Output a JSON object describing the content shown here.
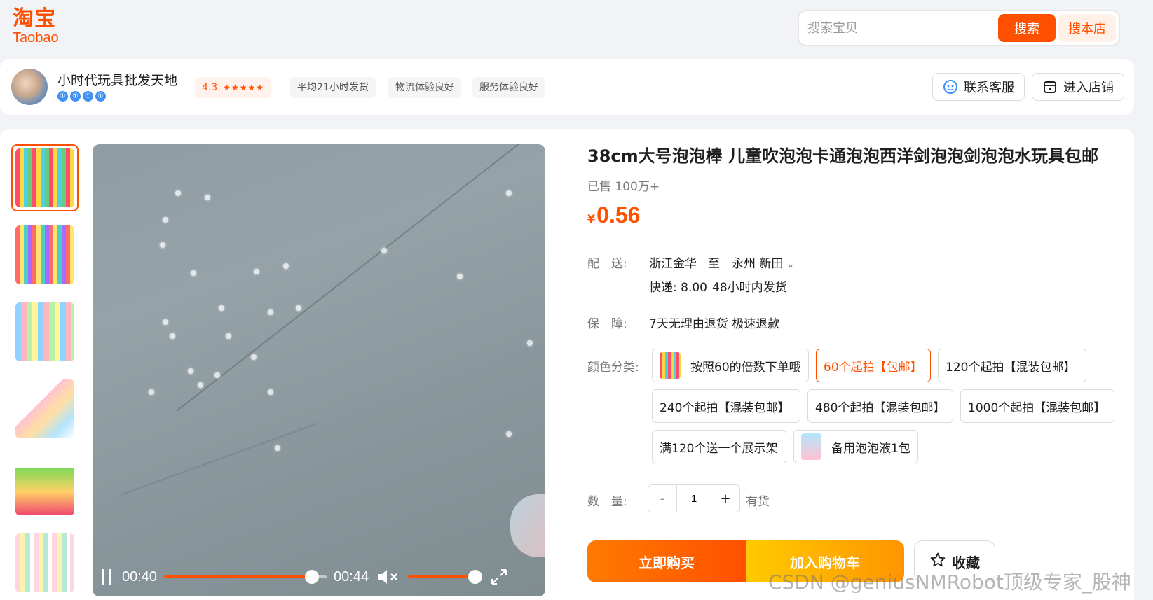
{
  "logo": {
    "cn": "淘宝",
    "en": "Taobao"
  },
  "search": {
    "placeholder": "搜索宝贝",
    "search_btn": "搜索",
    "shop_search_btn": "搜本店"
  },
  "shop": {
    "name": "小时代玩具批发天地",
    "rating": "4.3",
    "stars": "★★★★★",
    "crowns": [
      "①",
      "①",
      "①",
      "①"
    ],
    "tags": [
      "平均21小时发货",
      "物流体验良好",
      "服务体验良好"
    ],
    "contact_btn": "联系客服",
    "enter_btn": "进入店铺"
  },
  "video": {
    "current_time": "00:40",
    "duration": "00:44",
    "progress": 0.91,
    "volume": 1.0
  },
  "product": {
    "title": "38cm大号泡泡棒 儿童吹泡泡卡通泡泡西洋剑泡泡剑泡泡水玩具包邮",
    "sold": "已售 100万+",
    "currency": "¥",
    "price": "0.56"
  },
  "delivery": {
    "label": "配　送:",
    "from": "浙江金华",
    "to_word": "至",
    "to": "永州 新田",
    "express": "快递: 8.00",
    "ship_time": "48小时内发货"
  },
  "guarantee": {
    "label": "保　障:",
    "text": "7天无理由退货 极速退款"
  },
  "color": {
    "label": "颜色分类:",
    "options": [
      "按照60的倍数下单哦",
      "60个起拍【包邮】",
      "120个起拍【混装包邮】",
      "240个起拍【混装包邮】",
      "480个起拍【混装包邮】",
      "1000个起拍【混装包邮】",
      "满120个送一个展示架",
      "备用泡泡液1包"
    ],
    "selected": "60个起拍【包邮】"
  },
  "quantity": {
    "label": "数　量:",
    "minus": "-",
    "value": "1",
    "plus": "+",
    "stock": "有货"
  },
  "actions": {
    "buy": "立即购买",
    "cart": "加入购物车",
    "favorite": "收藏"
  },
  "watermark": "CSDN @geniusNMRobot顶级专家_股神",
  "colors": {
    "accent": "#ff5000",
    "cart": "#ffb300",
    "badge": "#3f8ff5"
  }
}
